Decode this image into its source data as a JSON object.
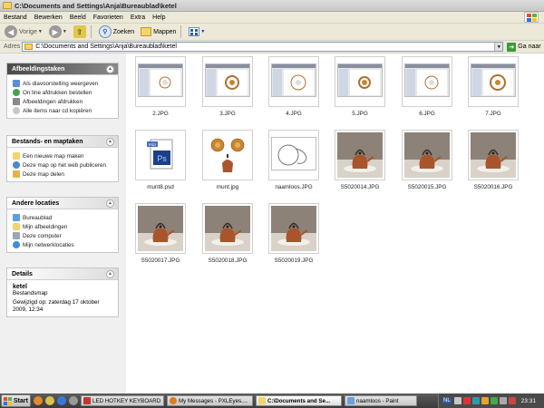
{
  "window": {
    "title": "C:\\Documents and Settings\\Anja\\Bureaublad\\ketel"
  },
  "menu": [
    "Bestand",
    "Bewerken",
    "Beeld",
    "Favorieten",
    "Extra",
    "Help"
  ],
  "toolbar": {
    "back": "Vorige",
    "search": "Zoeken",
    "folders": "Mappen"
  },
  "address": {
    "label": "Adres",
    "value": "C:\\Documents and Settings\\Anja\\Bureaublad\\ketel",
    "go": "Ga naar"
  },
  "taskpane": {
    "picture_tasks": {
      "title": "Afbeeldingstaken",
      "items": [
        "Als diavoorstelling weergeven",
        "On line afdrukken bestellen",
        "Afbeeldingen afdrukken",
        "Alle items naar cd kopiëren"
      ]
    },
    "file_tasks": {
      "title": "Bestands- en maptaken",
      "items": [
        "Een nieuwe map maken",
        "Deze map op het web publiceren",
        "Deze map delen"
      ]
    },
    "other_places": {
      "title": "Andere locaties",
      "items": [
        "Bureaublad",
        "Mijn afbeeldingen",
        "Deze computer",
        "Mijn netwerklocaties"
      ]
    },
    "details": {
      "title": "Details",
      "name": "ketel",
      "type": "Bestandsmap",
      "modified": "Gewijzigd op: zaterdag 17 oktober 2009, 12:34"
    }
  },
  "files": [
    {
      "name": "2.JPG",
      "kind": "screenshot"
    },
    {
      "name": "3.JPG",
      "kind": "screenshot"
    },
    {
      "name": "4.JPG",
      "kind": "screenshot"
    },
    {
      "name": "5.JPG",
      "kind": "screenshot"
    },
    {
      "name": "6.JPG",
      "kind": "screenshot"
    },
    {
      "name": "7.JPG",
      "kind": "screenshot"
    },
    {
      "name": "munt8.psd",
      "kind": "psd"
    },
    {
      "name": "munt.jpg",
      "kind": "coins"
    },
    {
      "name": "naamloos.JPG",
      "kind": "sketch"
    },
    {
      "name": "S5020014.JPG",
      "kind": "kettle"
    },
    {
      "name": "S5020015.JPG",
      "kind": "kettle"
    },
    {
      "name": "S5020016.JPG",
      "kind": "kettle"
    },
    {
      "name": "S5020017.JPG",
      "kind": "kettle"
    },
    {
      "name": "S5020018.JPG",
      "kind": "kettle"
    },
    {
      "name": "S5020019.JPG",
      "kind": "kettle"
    }
  ],
  "taskbar": {
    "start": "Start",
    "buttons": [
      {
        "label": "LED HOTKEY KEYBOARD",
        "active": false
      },
      {
        "label": "My Messages - PXLEyes....",
        "active": false
      },
      {
        "label": "C:\\Documents and Se...",
        "active": true
      },
      {
        "label": "naamloos - Paint",
        "active": false
      }
    ],
    "tray_lang": "NL",
    "clock": "23:31"
  },
  "colors": {
    "folder": "#f3d36b",
    "link_blue": "#2c5bb0",
    "copper": "#a8552b"
  }
}
